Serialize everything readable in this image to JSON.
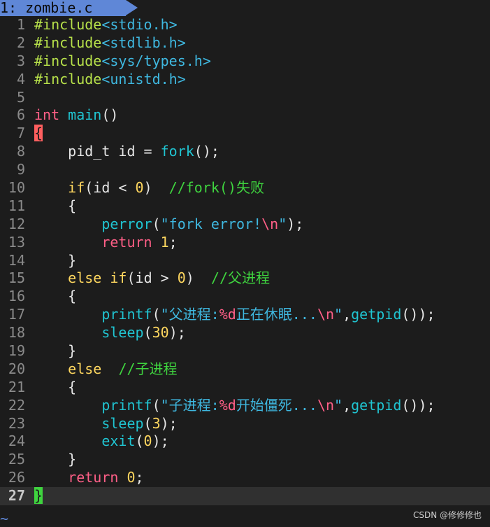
{
  "tab": {
    "label": "1: zombie.c"
  },
  "lines": [
    {
      "n": "1",
      "segs": [
        {
          "c": "pp",
          "t": "#include"
        },
        {
          "c": "hdr",
          "t": "<stdio.h>"
        }
      ]
    },
    {
      "n": "2",
      "segs": [
        {
          "c": "pp",
          "t": "#include"
        },
        {
          "c": "hdr",
          "t": "<stdlib.h>"
        }
      ]
    },
    {
      "n": "3",
      "segs": [
        {
          "c": "pp",
          "t": "#include"
        },
        {
          "c": "hdr",
          "t": "<sys/types.h>"
        }
      ]
    },
    {
      "n": "4",
      "segs": [
        {
          "c": "pp",
          "t": "#include"
        },
        {
          "c": "hdr",
          "t": "<unistd.h>"
        }
      ]
    },
    {
      "n": "5",
      "segs": []
    },
    {
      "n": "6",
      "segs": [
        {
          "c": "type",
          "t": "int"
        },
        {
          "c": "plain",
          "t": " "
        },
        {
          "c": "fn",
          "t": "main"
        },
        {
          "c": "plain",
          "t": "()"
        }
      ]
    },
    {
      "n": "7",
      "segs": [
        {
          "c": "brace-red",
          "t": "{"
        }
      ]
    },
    {
      "n": "8",
      "segs": [
        {
          "c": "plain",
          "t": "    pid_t id = "
        },
        {
          "c": "fn",
          "t": "fork"
        },
        {
          "c": "plain",
          "t": "();"
        }
      ]
    },
    {
      "n": "9",
      "segs": []
    },
    {
      "n": "10",
      "segs": [
        {
          "c": "plain",
          "t": "    "
        },
        {
          "c": "kw",
          "t": "if"
        },
        {
          "c": "plain",
          "t": "(id < "
        },
        {
          "c": "num",
          "t": "0"
        },
        {
          "c": "plain",
          "t": ")  "
        },
        {
          "c": "cm",
          "t": "//fork()失败"
        }
      ]
    },
    {
      "n": "11",
      "segs": [
        {
          "c": "plain",
          "t": "    {"
        }
      ]
    },
    {
      "n": "12",
      "segs": [
        {
          "c": "plain",
          "t": "        "
        },
        {
          "c": "fn",
          "t": "perror"
        },
        {
          "c": "plain",
          "t": "("
        },
        {
          "c": "str",
          "t": "\"fork error!"
        },
        {
          "c": "esc",
          "t": "\\n"
        },
        {
          "c": "str",
          "t": "\""
        },
        {
          "c": "plain",
          "t": ");"
        }
      ]
    },
    {
      "n": "13",
      "segs": [
        {
          "c": "plain",
          "t": "        "
        },
        {
          "c": "ret",
          "t": "return"
        },
        {
          "c": "plain",
          "t": " "
        },
        {
          "c": "num",
          "t": "1"
        },
        {
          "c": "plain",
          "t": ";"
        }
      ]
    },
    {
      "n": "14",
      "segs": [
        {
          "c": "plain",
          "t": "    }"
        }
      ]
    },
    {
      "n": "15",
      "segs": [
        {
          "c": "plain",
          "t": "    "
        },
        {
          "c": "kw",
          "t": "else"
        },
        {
          "c": "plain",
          "t": " "
        },
        {
          "c": "kw",
          "t": "if"
        },
        {
          "c": "plain",
          "t": "(id > "
        },
        {
          "c": "num",
          "t": "0"
        },
        {
          "c": "plain",
          "t": ")  "
        },
        {
          "c": "cm",
          "t": "//父进程"
        }
      ]
    },
    {
      "n": "16",
      "segs": [
        {
          "c": "plain",
          "t": "    {"
        }
      ]
    },
    {
      "n": "17",
      "segs": [
        {
          "c": "plain",
          "t": "        "
        },
        {
          "c": "fn",
          "t": "printf"
        },
        {
          "c": "plain",
          "t": "("
        },
        {
          "c": "str",
          "t": "\"父进程:"
        },
        {
          "c": "esc",
          "t": "%d"
        },
        {
          "c": "str",
          "t": "正在休眠..."
        },
        {
          "c": "esc",
          "t": "\\n"
        },
        {
          "c": "str",
          "t": "\""
        },
        {
          "c": "plain",
          "t": ","
        },
        {
          "c": "fn",
          "t": "getpid"
        },
        {
          "c": "plain",
          "t": "());"
        }
      ]
    },
    {
      "n": "18",
      "segs": [
        {
          "c": "plain",
          "t": "        "
        },
        {
          "c": "fn",
          "t": "sleep"
        },
        {
          "c": "plain",
          "t": "("
        },
        {
          "c": "num",
          "t": "30"
        },
        {
          "c": "plain",
          "t": ");"
        }
      ]
    },
    {
      "n": "19",
      "segs": [
        {
          "c": "plain",
          "t": "    }"
        }
      ]
    },
    {
      "n": "20",
      "segs": [
        {
          "c": "plain",
          "t": "    "
        },
        {
          "c": "kw",
          "t": "else"
        },
        {
          "c": "plain",
          "t": "  "
        },
        {
          "c": "cm",
          "t": "//子进程"
        }
      ]
    },
    {
      "n": "21",
      "segs": [
        {
          "c": "plain",
          "t": "    {"
        }
      ]
    },
    {
      "n": "22",
      "segs": [
        {
          "c": "plain",
          "t": "        "
        },
        {
          "c": "fn",
          "t": "printf"
        },
        {
          "c": "plain",
          "t": "("
        },
        {
          "c": "str",
          "t": "\"子进程:"
        },
        {
          "c": "esc",
          "t": "%d"
        },
        {
          "c": "str",
          "t": "开始僵死..."
        },
        {
          "c": "esc",
          "t": "\\n"
        },
        {
          "c": "str",
          "t": "\""
        },
        {
          "c": "plain",
          "t": ","
        },
        {
          "c": "fn",
          "t": "getpid"
        },
        {
          "c": "plain",
          "t": "());"
        }
      ]
    },
    {
      "n": "23",
      "segs": [
        {
          "c": "plain",
          "t": "        "
        },
        {
          "c": "fn",
          "t": "sleep"
        },
        {
          "c": "plain",
          "t": "("
        },
        {
          "c": "num",
          "t": "3"
        },
        {
          "c": "plain",
          "t": ");"
        }
      ]
    },
    {
      "n": "24",
      "segs": [
        {
          "c": "plain",
          "t": "        "
        },
        {
          "c": "fn",
          "t": "exit"
        },
        {
          "c": "plain",
          "t": "("
        },
        {
          "c": "num",
          "t": "0"
        },
        {
          "c": "plain",
          "t": ");"
        }
      ]
    },
    {
      "n": "25",
      "segs": [
        {
          "c": "plain",
          "t": "    }"
        }
      ]
    },
    {
      "n": "26",
      "segs": [
        {
          "c": "plain",
          "t": "    "
        },
        {
          "c": "ret",
          "t": "return"
        },
        {
          "c": "plain",
          "t": " "
        },
        {
          "c": "num",
          "t": "0"
        },
        {
          "c": "plain",
          "t": ";"
        }
      ]
    },
    {
      "n": "27",
      "segs": [
        {
          "c": "brace-green",
          "t": "}"
        }
      ],
      "current": true
    }
  ],
  "empty_marker": "~",
  "watermark": "CSDN @修修修也",
  "colors": {
    "background": "#1c1c1c",
    "tab": "#5f87d7",
    "preprocessor": "#b7e14a",
    "string": "#3fb8e0",
    "keyword": "#ffd75f",
    "function": "#20c5d2",
    "comment": "#3fd43f",
    "type": "#ff5f87"
  }
}
